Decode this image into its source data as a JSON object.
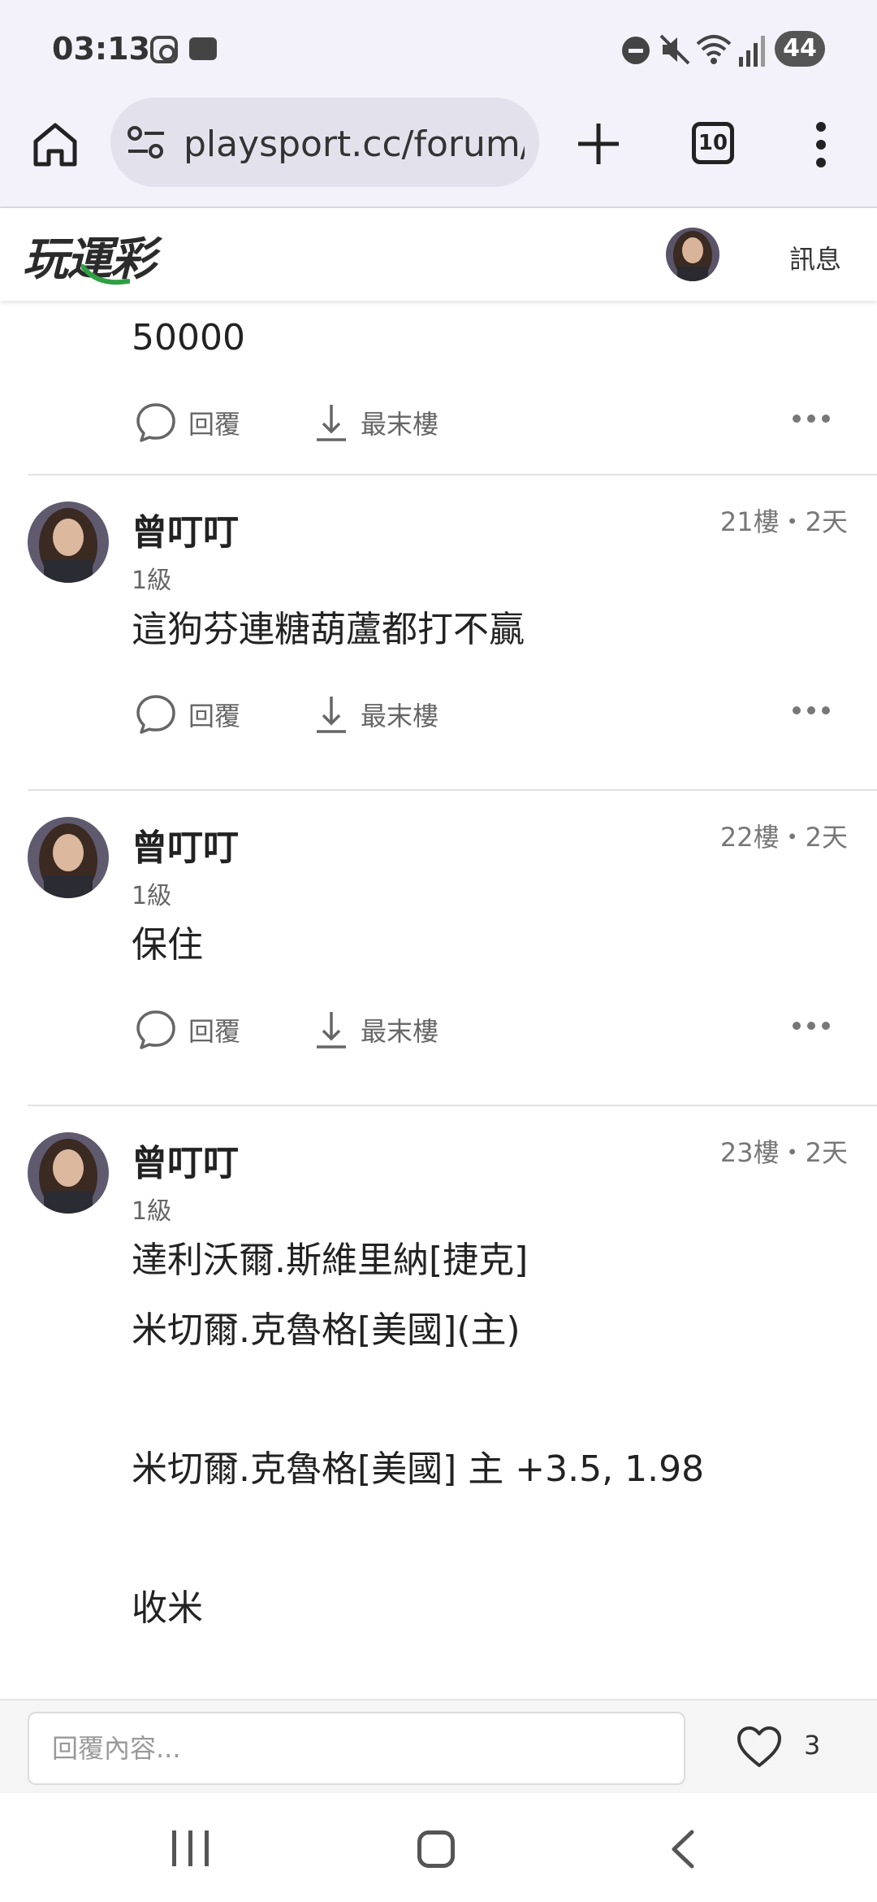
{
  "status_bar": {
    "time": "03:13",
    "battery": "44",
    "icons": [
      "instagram-icon",
      "message-icon",
      "dnd-icon",
      "mute-icon",
      "wifi-icon",
      "signal-icon",
      "battery-icon"
    ]
  },
  "browser": {
    "url": "playsport.cc/forum/p",
    "tab_count": "10"
  },
  "site": {
    "logo": "玩運彩",
    "messages_label": "訊息"
  },
  "posts": [
    {
      "lines": [
        "50000"
      ],
      "reply_label": "回覆",
      "last_floor_label": "最末樓"
    },
    {
      "username": "曾叮叮",
      "level": "1級",
      "meta": "21樓・2天",
      "lines": [
        "這狗芬連糖葫蘆都打不贏"
      ],
      "reply_label": "回覆",
      "last_floor_label": "最末樓"
    },
    {
      "username": "曾叮叮",
      "level": "1級",
      "meta": "22樓・2天",
      "lines": [
        "保住"
      ],
      "reply_label": "回覆",
      "last_floor_label": "最末樓"
    },
    {
      "username": "曾叮叮",
      "level": "1級",
      "meta": "23樓・2天",
      "lines": [
        "達利沃爾.斯維里納[捷克]",
        "米切爾.克魯格[美國](主)",
        "",
        "米切爾.克魯格[美國] 主 +3.5, 1.98",
        "",
        "收米"
      ]
    }
  ],
  "reply_bar": {
    "placeholder": "回覆內容...",
    "like_count": "3"
  },
  "colors": {
    "status_bg": "#f3f2fa",
    "url_pill": "#e3e2ec",
    "logo_green": "#2ea043",
    "text": "#222222",
    "muted": "#777777"
  }
}
